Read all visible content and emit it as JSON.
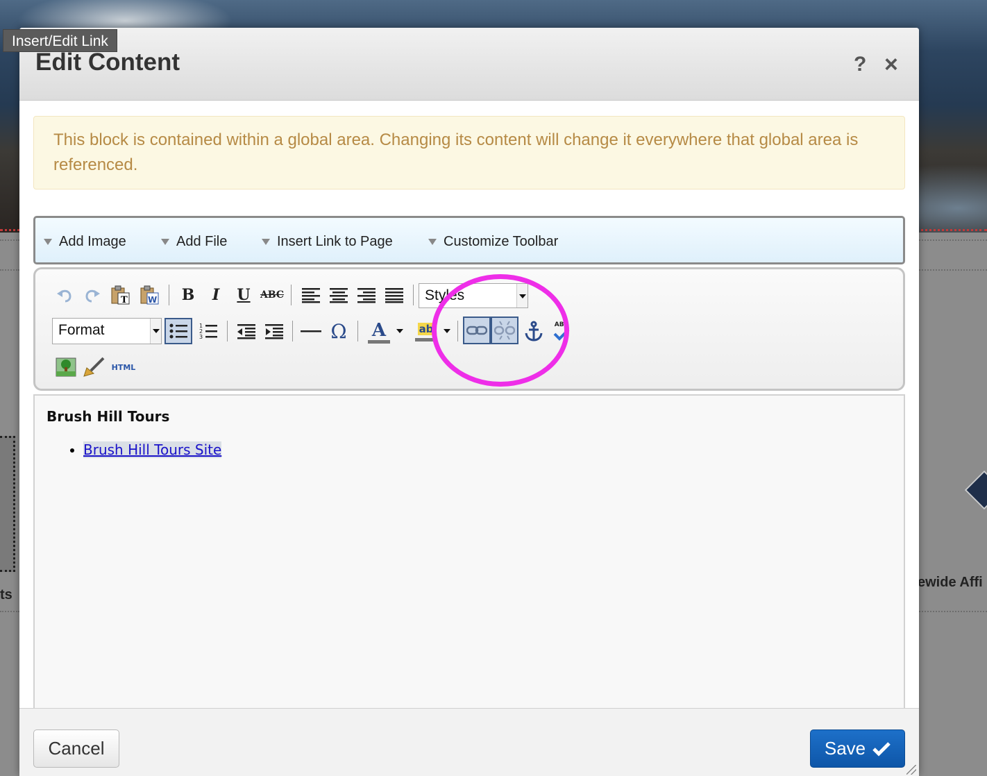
{
  "tooltip": {
    "text": "Insert/Edit Link"
  },
  "dialog": {
    "title": "Edit Content",
    "help_label": "?",
    "close_label": "×"
  },
  "alert": {
    "text": "This block is contained within a global area. Changing its content will change it everywhere that global area is referenced."
  },
  "top_toolbar": {
    "items": [
      {
        "label": "Add Image"
      },
      {
        "label": "Add File"
      },
      {
        "label": "Insert Link to Page"
      },
      {
        "label": "Customize Toolbar"
      }
    ]
  },
  "editor_toolbar": {
    "styles_dropdown": "Styles",
    "format_dropdown": "Format",
    "buttons": [
      "undo-icon",
      "redo-icon",
      "paste-text-icon",
      "paste-word-icon",
      "bold-icon",
      "italic-icon",
      "underline-icon",
      "strikethrough-icon",
      "align-left-icon",
      "align-center-icon",
      "align-right-icon",
      "align-justify-icon",
      "bulleted-list-icon",
      "numbered-list-icon",
      "outdent-icon",
      "indent-icon",
      "horizontal-rule-icon",
      "special-char-icon",
      "text-color-icon",
      "highlight-color-icon",
      "link-icon",
      "unlink-icon",
      "anchor-icon",
      "spellcheck-icon",
      "image-icon",
      "clean-format-icon",
      "html-source-icon"
    ],
    "bold_glyph": "B",
    "italic_glyph": "I",
    "underline_glyph": "U",
    "strike_glyph": "ABC",
    "omega_glyph": "Ω",
    "text_color_glyph": "A",
    "highlight_glyph": "ab",
    "html_glyph": "HTML",
    "spell_glyph": "ABC"
  },
  "content": {
    "heading": "Brush Hill Tours",
    "list": [
      {
        "text": "Brush Hill Tours Site"
      }
    ]
  },
  "footer": {
    "cancel_label": "Cancel",
    "save_label": "Save",
    "save_icon": "checkmark-icon"
  },
  "background": {
    "partial_text_left": "ts",
    "partial_text_right": "ewide Affi"
  },
  "colors": {
    "annotation_circle": "#ee2ee8",
    "save_button": "#1466be",
    "alert_text": "#b68a45",
    "alert_bg": "#fcf8e3"
  }
}
